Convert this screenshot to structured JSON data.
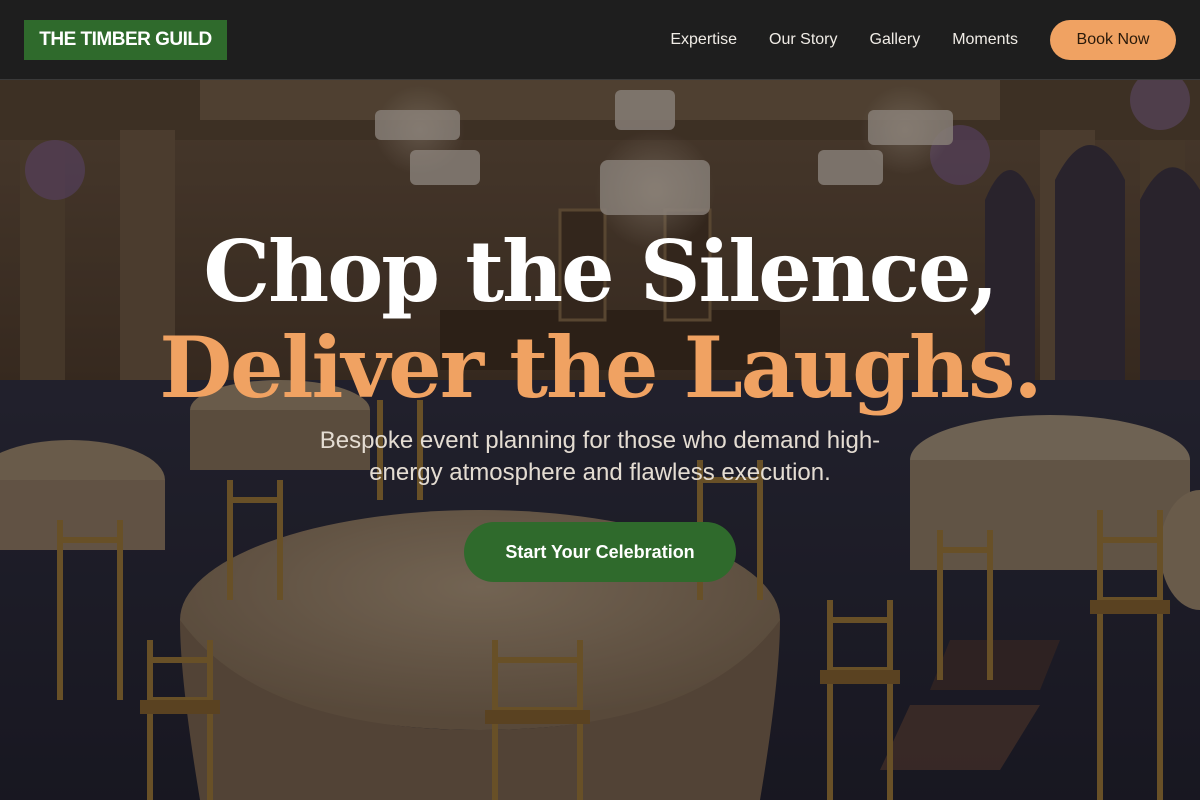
{
  "header": {
    "logo": "THE TIMBER GUILD",
    "nav": [
      "Expertise",
      "Our Story",
      "Gallery",
      "Moments"
    ],
    "book_label": "Book Now"
  },
  "hero": {
    "title_line1": "Chop the Silence,",
    "title_line2": "Deliver the Laughs.",
    "subtitle": "Bespoke event planning for those who demand high-energy atmosphere and flawless execution.",
    "cta_label": "Start Your Celebration"
  },
  "colors": {
    "accent_orange": "#f0a262",
    "brand_green": "#2f6a2c",
    "header_bg": "#1e1e1e"
  }
}
